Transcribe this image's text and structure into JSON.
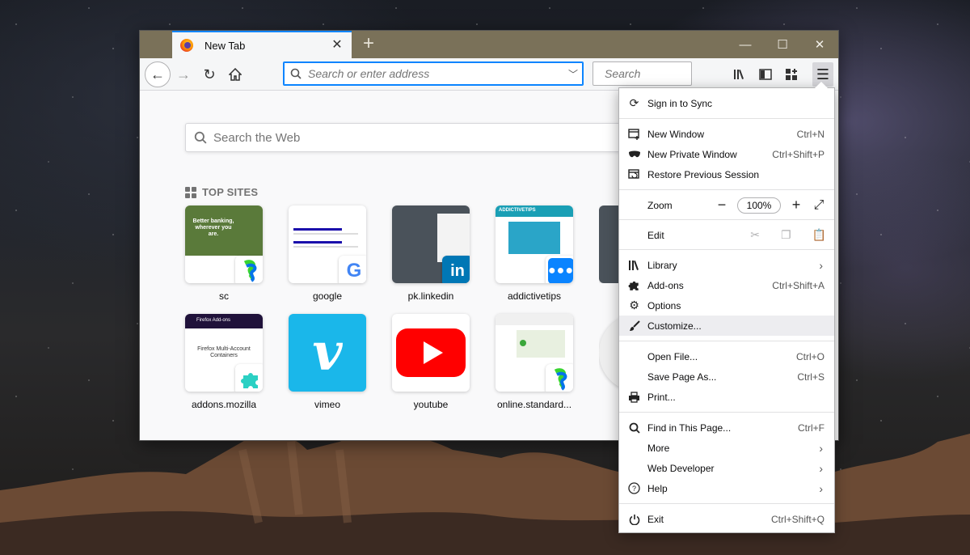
{
  "tab": {
    "title": "New Tab"
  },
  "toolbar": {
    "url_placeholder": "Search or enter address",
    "search_placeholder": "Search"
  },
  "newtab": {
    "search_placeholder": "Search the Web",
    "topsites_title": "TOP SITES",
    "sites": [
      {
        "label": "sc"
      },
      {
        "label": "google"
      },
      {
        "label": "pk.linkedin"
      },
      {
        "label": "addictivetips"
      },
      {
        "label": "addons.mozilla"
      },
      {
        "label": "vimeo"
      },
      {
        "label": "youtube"
      },
      {
        "label": "online.standard..."
      }
    ],
    "thumb_texts": {
      "sc_banner": "Better banking, wherever you are.",
      "addictivetips_logo": "ADDICTIVETIPS",
      "addons_title": "Firefox Multi-Account Containers",
      "addons_header": "Firefox Add-ons"
    }
  },
  "menu": {
    "sign_in": "Sign in to Sync",
    "new_window": {
      "label": "New Window",
      "shortcut": "Ctrl+N"
    },
    "new_private": {
      "label": "New Private Window",
      "shortcut": "Ctrl+Shift+P"
    },
    "restore": {
      "label": "Restore Previous Session"
    },
    "zoom": {
      "label": "Zoom",
      "value": "100%"
    },
    "edit": {
      "label": "Edit"
    },
    "library": {
      "label": "Library"
    },
    "addons": {
      "label": "Add-ons",
      "shortcut": "Ctrl+Shift+A"
    },
    "options": {
      "label": "Options"
    },
    "customize": {
      "label": "Customize..."
    },
    "open_file": {
      "label": "Open File...",
      "shortcut": "Ctrl+O"
    },
    "save_page": {
      "label": "Save Page As...",
      "shortcut": "Ctrl+S"
    },
    "print": {
      "label": "Print..."
    },
    "find": {
      "label": "Find in This Page...",
      "shortcut": "Ctrl+F"
    },
    "more": {
      "label": "More"
    },
    "web_dev": {
      "label": "Web Developer"
    },
    "help": {
      "label": "Help"
    },
    "exit": {
      "label": "Exit",
      "shortcut": "Ctrl+Shift+Q"
    }
  },
  "colors": {
    "titlebar": "#7a7159",
    "accent": "#0a84ff",
    "linkedin": "#0077b5",
    "vimeo": "#1ab7ea",
    "youtube": "#ff0000"
  }
}
